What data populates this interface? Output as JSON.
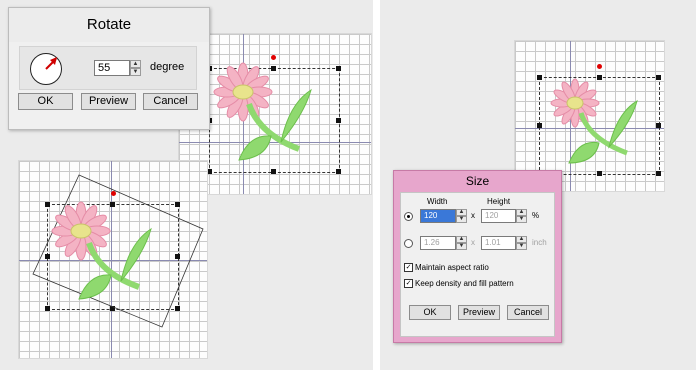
{
  "rotate_dialog": {
    "title": "Rotate",
    "angle_value": "55",
    "angle_unit": "degree",
    "buttons": {
      "ok": "OK",
      "preview": "Preview",
      "cancel": "Cancel"
    }
  },
  "size_dialog": {
    "title": "Size",
    "width_header": "Width",
    "height_header": "Height",
    "percent_row": {
      "width": "120",
      "height": "120",
      "times": "x",
      "unit": "%",
      "selected": true
    },
    "inch_row": {
      "width": "1.26",
      "height": "1.01",
      "times": "x",
      "unit": "inch",
      "selected": false
    },
    "maintain_aspect_ratio": "Maintain aspect ratio",
    "keep_density": "Keep density and fill pattern",
    "buttons": {
      "ok": "OK",
      "preview": "Preview",
      "cancel": "Cancel"
    }
  },
  "colors": {
    "petal_pink": "#f4b3c4",
    "flower_center": "#e8e48c",
    "leaf_green": "#8fd96f",
    "size_dialog_frame": "#e7a6cc",
    "selection_handle_red": "#e00000"
  }
}
